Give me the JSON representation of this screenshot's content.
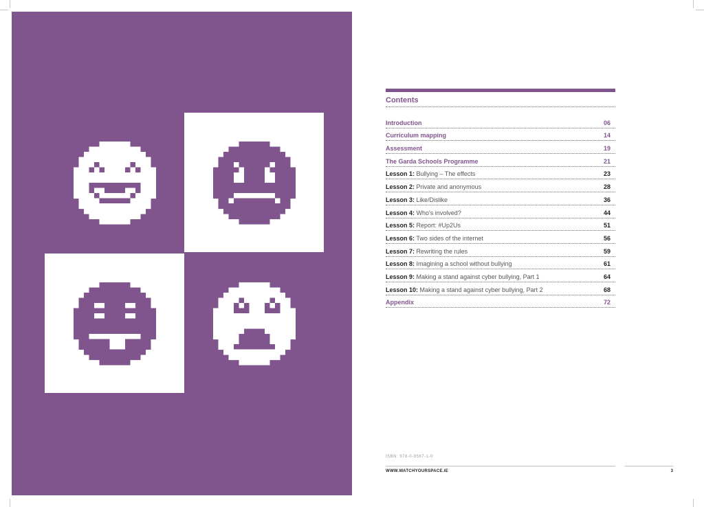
{
  "contents": {
    "title": "Contents",
    "entries": [
      {
        "lesson": "",
        "title": "Introduction",
        "page": "06",
        "style": "purple"
      },
      {
        "lesson": "",
        "title": "Curriculum mapping",
        "page": "14",
        "style": "purple"
      },
      {
        "lesson": "",
        "title": "Assessment",
        "page": "19",
        "style": "purple"
      },
      {
        "lesson": "",
        "title": "The Garda Schools Programme",
        "page": "21",
        "style": "purple"
      },
      {
        "lesson": "Lesson 1:",
        "title": "Bullying – The effects",
        "page": "23",
        "style": "lesson"
      },
      {
        "lesson": "Lesson 2:",
        "title": "Private and anonymous",
        "page": "28",
        "style": "lesson"
      },
      {
        "lesson": "Lesson 3:",
        "title": "Like/Dislike",
        "page": "36",
        "style": "lesson"
      },
      {
        "lesson": "Lesson 4:",
        "title": "Who's involved?",
        "page": "44",
        "style": "lesson"
      },
      {
        "lesson": "Lesson 5:",
        "title": "Report: #Up2Us",
        "page": "51",
        "style": "lesson"
      },
      {
        "lesson": "Lesson 6:",
        "title": "Two sides of the internet",
        "page": "56",
        "style": "lesson"
      },
      {
        "lesson": "Lesson 7:",
        "title": "Rewriting the rules",
        "page": "59",
        "style": "lesson"
      },
      {
        "lesson": "Lesson 8:",
        "title": "Imagining a school without bullying",
        "page": "61",
        "style": "lesson"
      },
      {
        "lesson": "Lesson 9:",
        "title": "Making a stand against cyber bullying, Part 1",
        "page": "64",
        "style": "lesson"
      },
      {
        "lesson": "Lesson 10:",
        "title": "Making a stand against cyber bullying, Part 2",
        "page": "68",
        "style": "lesson"
      },
      {
        "lesson": "",
        "title": "Appendix",
        "page": "72",
        "style": "purple"
      }
    ]
  },
  "footer": {
    "code": "ISBN: 978-0-9567-1-0",
    "url": "WWW.WATCHYOURSPACE.IE",
    "page_number": "3"
  },
  "illustration": {
    "emojis": [
      "laughing-emoji-icon",
      "frowning-emoji-icon",
      "tongue-out-emoji-icon",
      "shocked-emoji-icon"
    ],
    "colors": {
      "purple": "#80558e",
      "white": "#ffffff"
    }
  }
}
